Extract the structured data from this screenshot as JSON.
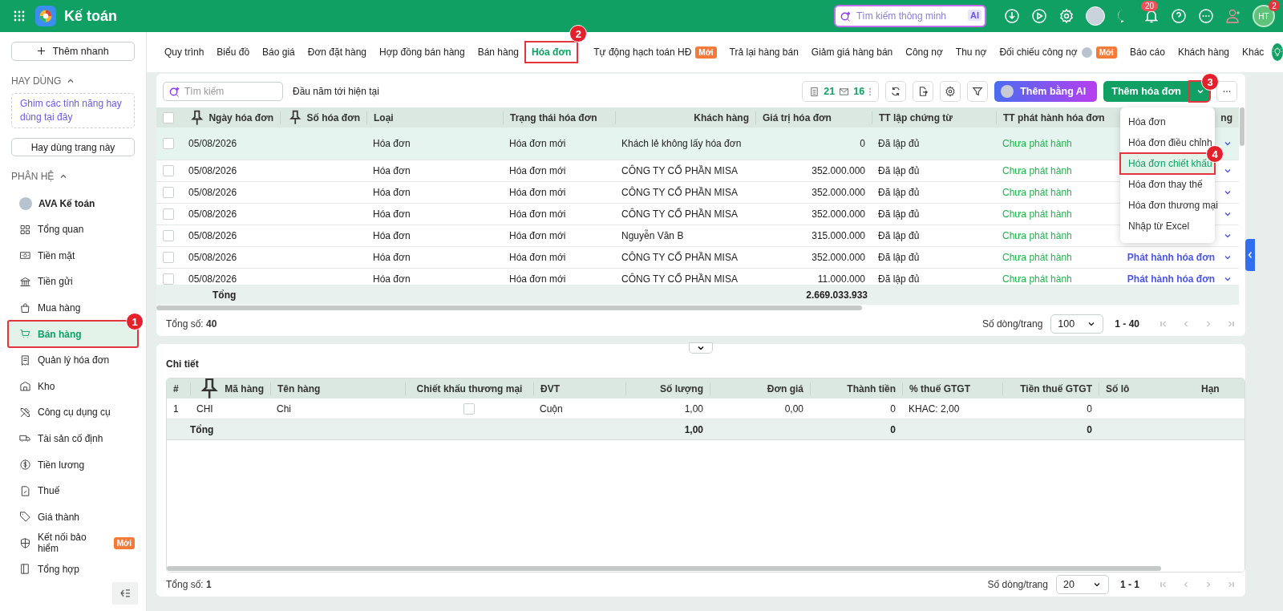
{
  "top_bar": {
    "app_name": "Kế toán",
    "search": {
      "placeholder": "Tìm kiếm thông minh",
      "badge": "AI"
    },
    "notifications": "20",
    "user": {
      "initials": "HT",
      "badge": "2"
    }
  },
  "sidebar": {
    "quick_add": "Thêm nhanh",
    "favorites": {
      "title": "HAY DÙNG",
      "expanded": true,
      "hint": "Ghim các tính năng hay dùng tại đây",
      "button": "Hay dùng trang này"
    },
    "modules": {
      "title": "PHÂN HỆ",
      "expanded": true,
      "items": [
        {
          "label": "AVA Kế toán",
          "selected": false
        },
        {
          "label": "Tổng quan",
          "selected": false
        },
        {
          "label": "Tiền mặt",
          "selected": false
        },
        {
          "label": "Tiền gửi",
          "selected": false
        },
        {
          "label": "Mua hàng",
          "selected": false
        },
        {
          "label": "Bán hàng",
          "selected": true,
          "callout": "1"
        },
        {
          "label": "Quản lý hóa đơn",
          "selected": false
        },
        {
          "label": "Kho",
          "selected": false
        },
        {
          "label": "Công cụ dụng cụ",
          "selected": false
        },
        {
          "label": "Tài sản cố định",
          "selected": false
        },
        {
          "label": "Tiền lương",
          "selected": false
        },
        {
          "label": "Thuế",
          "selected": false
        },
        {
          "label": "Giá thành",
          "selected": false
        },
        {
          "label": "Kết nối bảo hiểm",
          "selected": false,
          "badge": "Mới"
        },
        {
          "label": "Tổng hợp",
          "selected": false
        }
      ]
    }
  },
  "tabs": [
    {
      "label": "Quy trình",
      "selected": false
    },
    {
      "label": "Biểu đồ",
      "selected": false
    },
    {
      "label": "Báo giá",
      "selected": false
    },
    {
      "label": "Đơn đặt hàng",
      "selected": false
    },
    {
      "label": "Hợp đồng bán hàng",
      "selected": false
    },
    {
      "label": "Bán hàng",
      "selected": false
    },
    {
      "label": "Hóa đơn",
      "selected": true,
      "callout": "2"
    },
    {
      "label": "Tự động hạch toán HĐ",
      "selected": false,
      "badge": "Mới"
    },
    {
      "label": "Trả lại hàng bán",
      "selected": false
    },
    {
      "label": "Giảm giá hàng bán",
      "selected": false
    },
    {
      "label": "Công nợ",
      "selected": false
    },
    {
      "label": "Thu nợ",
      "selected": false
    },
    {
      "label": "Đối chiếu công nợ",
      "selected": false,
      "avatar": true,
      "badge": "Mới"
    },
    {
      "label": "Báo cáo",
      "selected": false
    },
    {
      "label": "Khách hàng",
      "selected": false
    },
    {
      "label": "Khác",
      "selected": false
    }
  ],
  "invoices": {
    "all_checked": false,
    "search": {
      "placeholder": "Tìm kiếm"
    },
    "period": "Đầu năm tới hiện tại",
    "counts": [
      "21",
      "16"
    ],
    "ai_button": "Thêm bằng AI",
    "add_button": {
      "label": "Thêm hóa đơn",
      "callout": "3"
    },
    "menu": [
      {
        "label": "Hóa đơn",
        "selected": false
      },
      {
        "label": "Hóa đơn điều chỉnh",
        "selected": false
      },
      {
        "label": "Hóa đơn chiết khấu",
        "selected": true,
        "callout": "4"
      },
      {
        "label": "Hóa đơn thay thế",
        "selected": false
      },
      {
        "label": "Hóa đơn thương mại",
        "selected": false
      },
      {
        "label": "Nhập từ Excel",
        "selected": false
      }
    ],
    "columns": [
      {
        "label": "Ngày hóa đơn",
        "pinned": true
      },
      {
        "label": "Số hóa đơn",
        "pinned": true
      },
      {
        "label": "Loại",
        "pinned": false
      },
      {
        "label": "Trạng thái hóa đơn",
        "pinned": false
      },
      {
        "label": "Khách hàng",
        "pinned": false
      },
      {
        "label": "Giá trị hóa đơn",
        "pinned": false
      },
      {
        "label": "TT lập chứng từ",
        "pinned": false
      },
      {
        "label": "TT phát hành hóa đơn",
        "pinned": false
      },
      {
        "label": "ng",
        "pinned": false
      }
    ],
    "rows": [
      {
        "checked": false,
        "selected": true,
        "date": "05/08/2026",
        "type": "Hóa đơn",
        "status": "Hóa đơn mới",
        "customer": "Khách lẻ không lấy hóa đơn",
        "value": "0",
        "doc_status": "Đã lập đủ",
        "issue_status": "Chưa phát hành"
      },
      {
        "checked": false,
        "selected": false,
        "date": "05/08/2026",
        "type": "Hóa đơn",
        "status": "Hóa đơn mới",
        "customer": "CÔNG TY CỔ PHẦN MISA",
        "value": "352.000.000",
        "doc_status": "Đã lập đủ",
        "issue_status": "Chưa phát hành"
      },
      {
        "checked": false,
        "selected": false,
        "date": "05/08/2026",
        "type": "Hóa đơn",
        "status": "Hóa đơn mới",
        "customer": "CÔNG TY CỔ PHẦN MISA",
        "value": "352.000.000",
        "doc_status": "Đã lập đủ",
        "issue_status": "Chưa phát hành"
      },
      {
        "checked": false,
        "selected": false,
        "date": "05/08/2026",
        "type": "Hóa đơn",
        "status": "Hóa đơn mới",
        "customer": "CÔNG TY CỔ PHẦN MISA",
        "value": "352.000.000",
        "doc_status": "Đã lập đủ",
        "issue_status": "Chưa phát hành"
      },
      {
        "checked": false,
        "selected": false,
        "date": "05/08/2026",
        "type": "Hóa đơn",
        "status": "Hóa đơn mới",
        "customer": "Nguyễn Văn B",
        "value": "315.000.000",
        "doc_status": "Đã lập đủ",
        "issue_status": "Chưa phát hành"
      },
      {
        "checked": false,
        "selected": false,
        "date": "05/08/2026",
        "type": "Hóa đơn",
        "status": "Hóa đơn mới",
        "customer": "CÔNG TY CỔ PHẦN MISA",
        "value": "352.000.000",
        "doc_status": "Đã lập đủ",
        "issue_status": "Chưa phát hành",
        "action": "Phát hành hóa đơn"
      },
      {
        "checked": false,
        "selected": false,
        "date": "05/08/2026",
        "type": "Hóa đơn",
        "status": "Hóa đơn mới",
        "customer": "CÔNG TY CỔ PHẦN MISA",
        "value": "11.000.000",
        "doc_status": "Đã lập đủ",
        "issue_status": "Chưa phát hành",
        "action": "Phát hành hóa đơn"
      }
    ],
    "totals": {
      "label": "Tổng",
      "value": "2.669.033.933"
    },
    "footer": {
      "total": "Tổng số: **40**",
      "page_size_label": "Số dòng/trang",
      "page_size": "100",
      "range": "1 - 40"
    }
  },
  "details": {
    "title": "Chi tiết",
    "columns": [
      {
        "label": "#",
        "pinned": false
      },
      {
        "label": "Mã hàng",
        "pinned": true
      },
      {
        "label": "Tên hàng",
        "pinned": false
      },
      {
        "label": "Chiết khấu thương mại",
        "pinned": false
      },
      {
        "label": "ĐVT",
        "pinned": false
      },
      {
        "label": "Số lượng",
        "pinned": false
      },
      {
        "label": "Đơn giá",
        "pinned": false
      },
      {
        "label": "Thành tiền",
        "pinned": false
      },
      {
        "label": "% thuế GTGT",
        "pinned": false
      },
      {
        "label": "Tiền thuế GTGT",
        "pinned": false
      },
      {
        "label": "Số lô",
        "pinned": false
      },
      {
        "label": "Hạn",
        "pinned": false
      }
    ],
    "rows": [
      {
        "index": "1",
        "code": "CHI",
        "name": "Chi",
        "discount": false,
        "unit": "Cuộn",
        "quantity": "1,00",
        "price": "0,00",
        "amount": "0",
        "vat_rate": "KHAC: 2,00",
        "vat_amount": "0"
      }
    ],
    "totals": {
      "label": "Tổng",
      "quantity": "1,00",
      "amount": "0",
      "vat_amount": "0"
    },
    "footer": {
      "total": "Tổng số: **1**",
      "page_size_label": "Số dòng/trang",
      "page_size": "20",
      "range": "1 - 1"
    }
  }
}
